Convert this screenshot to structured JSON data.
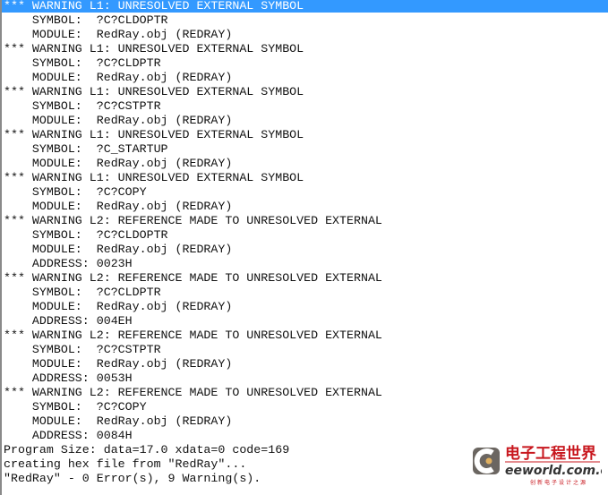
{
  "colors": {
    "selection": "#3399ff",
    "text": "#111111",
    "logo_red": "#c8171e"
  },
  "output": {
    "selected_index": 0,
    "lines": [
      "*** WARNING L1: UNRESOLVED EXTERNAL SYMBOL",
      "    SYMBOL:  ?C?CLDOPTR",
      "    MODULE:  RedRay.obj (REDRAY)",
      "*** WARNING L1: UNRESOLVED EXTERNAL SYMBOL",
      "    SYMBOL:  ?C?CLDPTR",
      "    MODULE:  RedRay.obj (REDRAY)",
      "*** WARNING L1: UNRESOLVED EXTERNAL SYMBOL",
      "    SYMBOL:  ?C?CSTPTR",
      "    MODULE:  RedRay.obj (REDRAY)",
      "*** WARNING L1: UNRESOLVED EXTERNAL SYMBOL",
      "    SYMBOL:  ?C_STARTUP",
      "    MODULE:  RedRay.obj (REDRAY)",
      "*** WARNING L1: UNRESOLVED EXTERNAL SYMBOL",
      "    SYMBOL:  ?C?COPY",
      "    MODULE:  RedRay.obj (REDRAY)",
      "*** WARNING L2: REFERENCE MADE TO UNRESOLVED EXTERNAL",
      "    SYMBOL:  ?C?CLDOPTR",
      "    MODULE:  RedRay.obj (REDRAY)",
      "    ADDRESS: 0023H",
      "*** WARNING L2: REFERENCE MADE TO UNRESOLVED EXTERNAL",
      "    SYMBOL:  ?C?CLDPTR",
      "    MODULE:  RedRay.obj (REDRAY)",
      "    ADDRESS: 004EH",
      "*** WARNING L2: REFERENCE MADE TO UNRESOLVED EXTERNAL",
      "    SYMBOL:  ?C?CSTPTR",
      "    MODULE:  RedRay.obj (REDRAY)",
      "    ADDRESS: 0053H",
      "*** WARNING L2: REFERENCE MADE TO UNRESOLVED EXTERNAL",
      "    SYMBOL:  ?C?COPY",
      "    MODULE:  RedRay.obj (REDRAY)",
      "    ADDRESS: 0084H",
      "Program Size: data=17.0 xdata=0 code=169",
      "creating hex file from \"RedRay\"...",
      "\"RedRay\" - 0 Error(s), 9 Warning(s)."
    ]
  },
  "watermark": {
    "cn": "电子工程世界",
    "en": "eeworld.com.cn",
    "slogan": "创新电子设计之源"
  }
}
